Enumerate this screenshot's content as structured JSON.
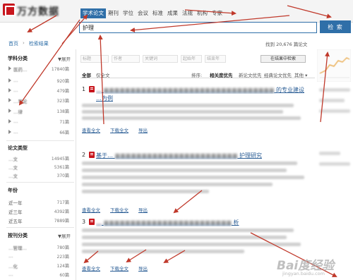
{
  "header": {
    "logo_text": "万方数据",
    "type_tabs": [
      {
        "label": "学术论文",
        "active": true
      },
      {
        "label": "期刊",
        "active": false
      },
      {
        "label": "学位",
        "active": false
      },
      {
        "label": "会议",
        "active": false
      },
      {
        "label": "标准",
        "active": false
      },
      {
        "label": "成果",
        "active": false
      },
      {
        "label": "法规",
        "active": false
      },
      {
        "label": "机构",
        "active": false
      },
      {
        "label": "专家",
        "active": false
      }
    ]
  },
  "search": {
    "query": "护理",
    "button_label": "检 索"
  },
  "breadcrumb": {
    "home": "首页",
    "separator": "›",
    "current": "检索结果"
  },
  "result_count": "找到 20,676 篇论文",
  "sidebar": {
    "subject": {
      "title": "学科分类",
      "toggle": "▼展开",
      "items": [
        {
          "label": "医药…",
          "count": "17840篇"
        },
        {
          "label": "…",
          "count": "920篇"
        },
        {
          "label": "…",
          "count": "479篇"
        },
        {
          "label": "…导论",
          "count": "323篇"
        },
        {
          "label": "…律",
          "count": "138篇"
        },
        {
          "label": "…",
          "count": "71篇"
        },
        {
          "label": "…",
          "count": "66篇"
        }
      ]
    },
    "paper_type": {
      "title": "论文类型",
      "items": [
        {
          "label": "…文",
          "count": "14945篇"
        },
        {
          "label": "…文",
          "count": "5361篇"
        },
        {
          "label": "…文",
          "count": "370篇"
        }
      ]
    },
    "year": {
      "title": "年份",
      "items": [
        {
          "label": "近一年",
          "count": "717篇"
        },
        {
          "label": "近三年",
          "count": "4392篇"
        },
        {
          "label": "近五年",
          "count": "7889篇"
        }
      ]
    },
    "journal": {
      "title": "按刊分类",
      "toggle": "▼展开",
      "items": [
        {
          "label": "…管理…",
          "count": "780篇"
        },
        {
          "label": "…",
          "count": "223篇"
        },
        {
          "label": "…化",
          "count": "124篇"
        },
        {
          "label": "…",
          "count": "60篇"
        }
      ]
    }
  },
  "filter_row": {
    "fields": [
      "标题",
      "作者",
      "关键词",
      "起始年",
      "结束年"
    ],
    "search_within_label": "在结果中检索"
  },
  "sort_bar": {
    "all_label": "全部",
    "fulltext_label": "仅全文",
    "sort_label": "排序:",
    "options": [
      {
        "label": "相关度优先",
        "active": true
      },
      {
        "label": "新论文优先",
        "active": false
      },
      {
        "label": "经典论文优先",
        "active": false
      },
      {
        "label": "其他 ▾",
        "active": false
      }
    ]
  },
  "results": [
    {
      "num": "1",
      "title_blurred": "…",
      "title_clear": "…为例",
      "title_tail": "的专业建设"
    },
    {
      "num": "2",
      "title_blurred": "基于…",
      "title_clear": "…",
      "title_tail": "护理研究"
    },
    {
      "num": "3",
      "title_blurred": "…",
      "title_clear": "…",
      "title_tail": "析"
    }
  ],
  "result_actions": [
    "查看全文",
    "下载全文",
    "导出"
  ],
  "watermark": {
    "brand": "Bai度经验",
    "url": "jingyan.baidu.com"
  },
  "colors": {
    "primary": "#2f6fa8",
    "brand_red": "#c8161d",
    "annotation_red": "#c0392b"
  }
}
